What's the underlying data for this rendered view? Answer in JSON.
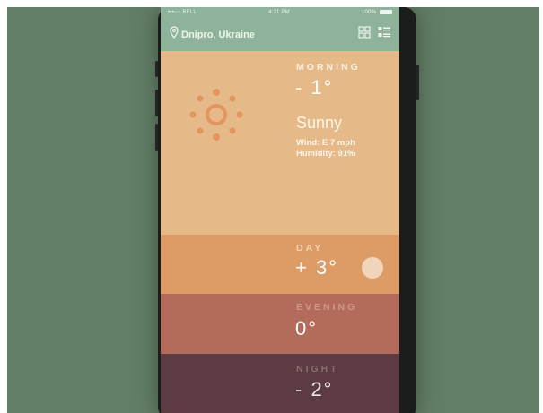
{
  "status_bar": {
    "carrier": "•••○○ BELL",
    "time": "4:21 PM",
    "battery": "100%"
  },
  "header": {
    "location": "Dnipro, Ukraine"
  },
  "morning": {
    "label": "MORNING",
    "temp": "- 1°",
    "condition": "Sunny",
    "wind": "Wind: E 7 mph",
    "humidity": "Humidity: 91%"
  },
  "day": {
    "label": "DAY",
    "temp": "+ 3°"
  },
  "evening": {
    "label": "EVENING",
    "temp": "0°"
  },
  "night": {
    "label": "NIGHT",
    "temp": "- 2°"
  },
  "colors": {
    "background": "#627e66",
    "header": "#8fb39a",
    "morning": "#e6b989",
    "day": "#dd9b66",
    "evening": "#b36c5b",
    "night": "#5c3b42",
    "sun": "#e2965d"
  }
}
